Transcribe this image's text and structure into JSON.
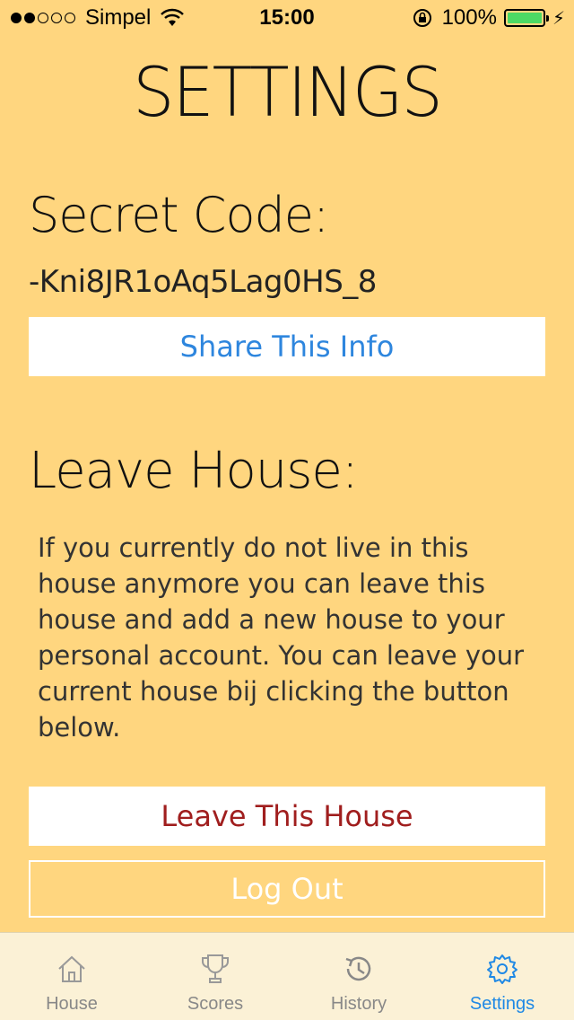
{
  "status_bar": {
    "carrier": "Simpel",
    "time": "15:00",
    "battery_percent": "100%",
    "signal_bars_filled": 2,
    "signal_bars_total": 5,
    "battery_color": "#4CD964"
  },
  "header": {
    "title": "SETTINGS"
  },
  "secret": {
    "heading": "Secret Code:",
    "code": "-Kni8JR1oAq5Lag0HS_8",
    "share_label": "Share This Info"
  },
  "leave": {
    "heading": "Leave House:",
    "description": "If you currently do not live in this house anymore you can leave this house and add a new house to your personal account. You can leave your current house bij clicking the button below.",
    "leave_label": "Leave This House"
  },
  "logout_label": "Log Out",
  "tabs": [
    {
      "label": "House",
      "icon": "house-icon",
      "active": false
    },
    {
      "label": "Scores",
      "icon": "trophy-icon",
      "active": false
    },
    {
      "label": "History",
      "icon": "history-icon",
      "active": false
    },
    {
      "label": "Settings",
      "icon": "gear-icon",
      "active": true
    }
  ],
  "colors": {
    "background": "#FFD67F",
    "accent": "#1E88E5",
    "share_text": "#2E86DE",
    "leave_text": "#A01E1E"
  }
}
